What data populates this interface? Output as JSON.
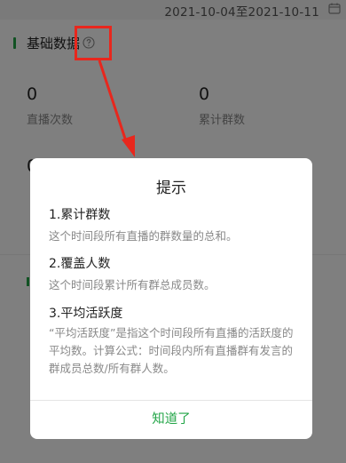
{
  "header": {
    "date_range": "2021-10-04至2021-10-11"
  },
  "section": {
    "title": "基础数据"
  },
  "stats": [
    {
      "value": "0",
      "label": "直播次数"
    },
    {
      "value": "0",
      "label": "累计群数"
    },
    {
      "value": "0",
      "label": ""
    }
  ],
  "dialog": {
    "title": "提示",
    "items": [
      {
        "title": "1.累计群数",
        "desc": "这个时间段所有直播的群数量的总和。"
      },
      {
        "title": "2.覆盖人数",
        "desc": "这个时间段累计所有群总成员数。"
      },
      {
        "title": "3.平均活跃度",
        "desc": "“平均活跃度”是指这个时间段所有直播的活跃度的平均数。计算公式：时间段内所有直播群有发言的群成员总数/所有群人数。"
      }
    ],
    "confirm_label": "知道了"
  },
  "colors": {
    "accent": "#22a547",
    "annotation": "#e8271d"
  },
  "icons": {
    "help": "question-circle-icon",
    "calendar": "calendar-icon"
  }
}
